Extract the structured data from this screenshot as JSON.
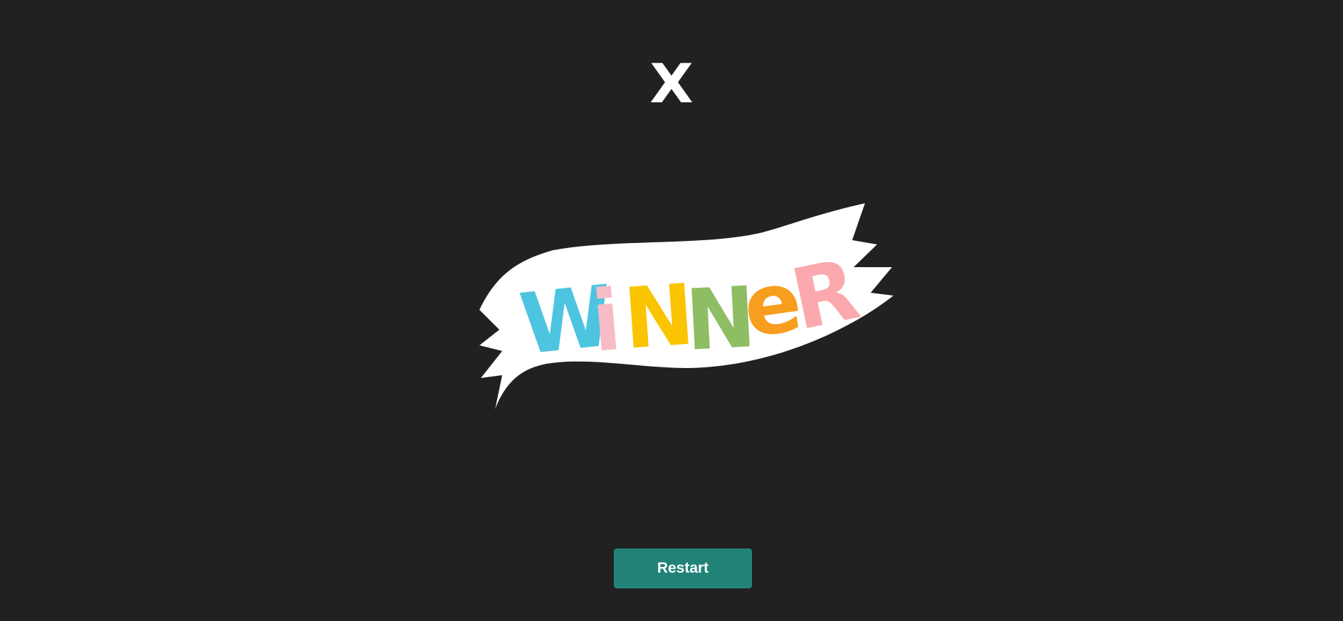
{
  "game": {
    "winner_mark": "X",
    "banner_text": "WiNNeR",
    "banner_letters": [
      {
        "char": "W",
        "color": "#4dc4e0"
      },
      {
        "char": "i",
        "color": "#f7bcc8"
      },
      {
        "char": "N",
        "color": "#fbc400"
      },
      {
        "char": "N",
        "color": "#8fbd63"
      },
      {
        "char": "e",
        "color": "#f79e1e"
      },
      {
        "char": "R",
        "color": "#fba9ae"
      }
    ],
    "restart_label": "Restart"
  },
  "colors": {
    "background": "#212121",
    "banner": "#ffffff",
    "button": "#218378",
    "text": "#ffffff"
  }
}
